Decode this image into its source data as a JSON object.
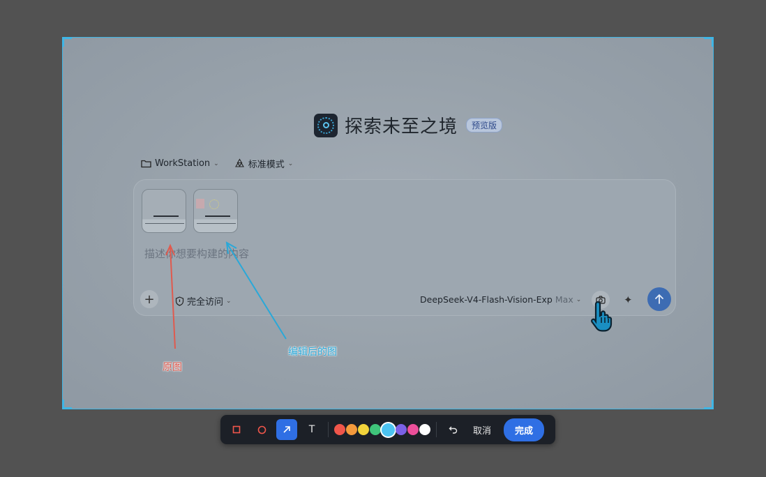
{
  "app": {
    "title": "探索未至之境",
    "badge": "预览版"
  },
  "meta": {
    "workspace": "WorkStation",
    "mode": "标准模式"
  },
  "composer": {
    "placeholder": "描述你想要构建的内容",
    "access": "完全访问",
    "model": "DeepSeek-V4-Flash-Vision-Exp",
    "model_tier": "Max"
  },
  "annotations": {
    "original_label": "原图",
    "edited_label": "编辑后的图"
  },
  "toolbar": {
    "tools": [
      "rectangle-tool",
      "ellipse-tool",
      "arrow-tool",
      "text-tool"
    ],
    "text_tool_label": "T",
    "active_tool": "arrow-tool",
    "colors": [
      "#f0564b",
      "#f49a3c",
      "#f2d33b",
      "#3fc47a",
      "#4cc3f0",
      "#7b61e6",
      "#ec4f9a",
      "#ffffff"
    ],
    "selected_color": "#4cc3f0",
    "undo": "undo-icon",
    "cancel_label": "取消",
    "done_label": "完成"
  },
  "colors": {
    "selection_border": "#3fb6e6",
    "accent": "#2f6fe4",
    "annotation_red": "#e05a4e",
    "annotation_cyan": "#2aa8d8"
  }
}
